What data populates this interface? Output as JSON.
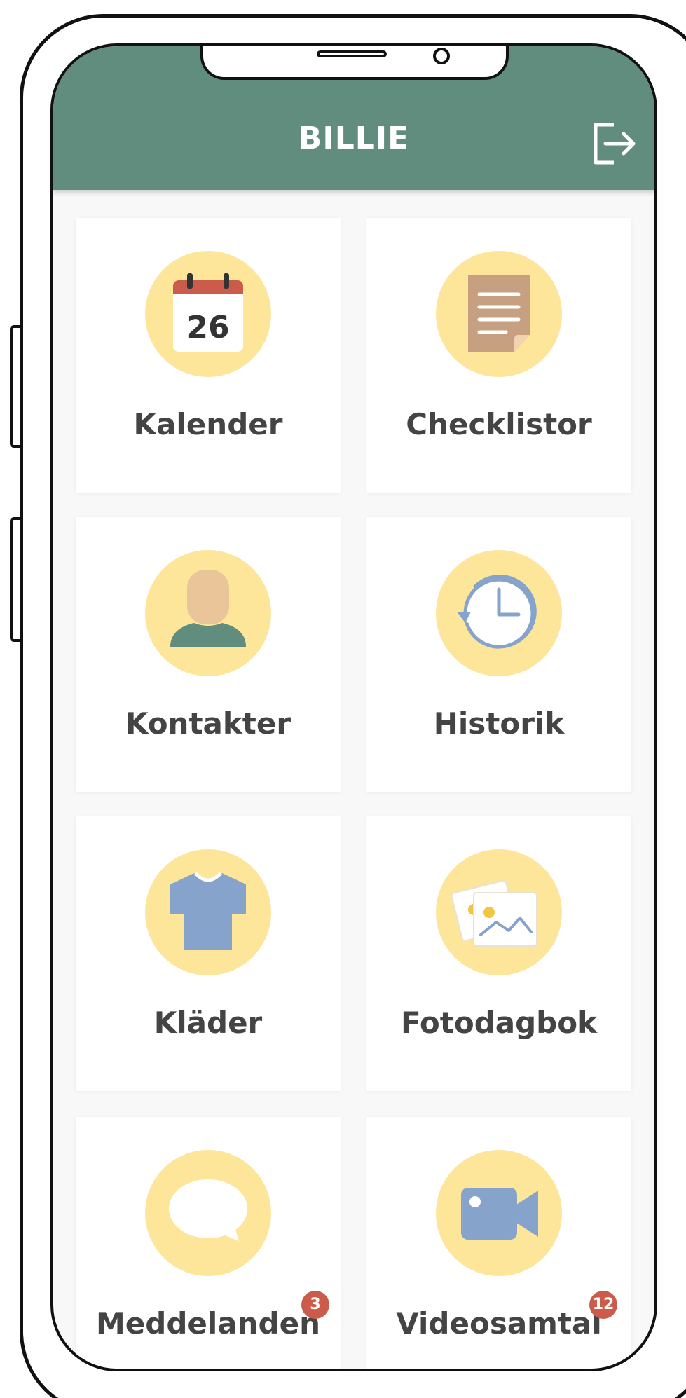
{
  "app": {
    "title": "BILLIE",
    "logout_icon": "logout-icon"
  },
  "colors": {
    "header": "#618d7e",
    "icon_circle": "#fde59a",
    "badge": "#cb5c4b",
    "label_text": "#444444"
  },
  "tiles": [
    {
      "label": "Kalender",
      "icon": "calendar-icon",
      "calendar_day": "26"
    },
    {
      "label": "Checklistor",
      "icon": "checklist-icon"
    },
    {
      "label": "Kontakter",
      "icon": "contact-icon"
    },
    {
      "label": "Historik",
      "icon": "history-icon"
    },
    {
      "label": "Kläder",
      "icon": "tshirt-icon"
    },
    {
      "label": "Fotodagbok",
      "icon": "photo-diary-icon"
    },
    {
      "label": "Meddelanden",
      "icon": "message-icon",
      "badge": "3"
    },
    {
      "label": "Videosamtal",
      "icon": "video-call-icon",
      "badge": "12"
    }
  ]
}
